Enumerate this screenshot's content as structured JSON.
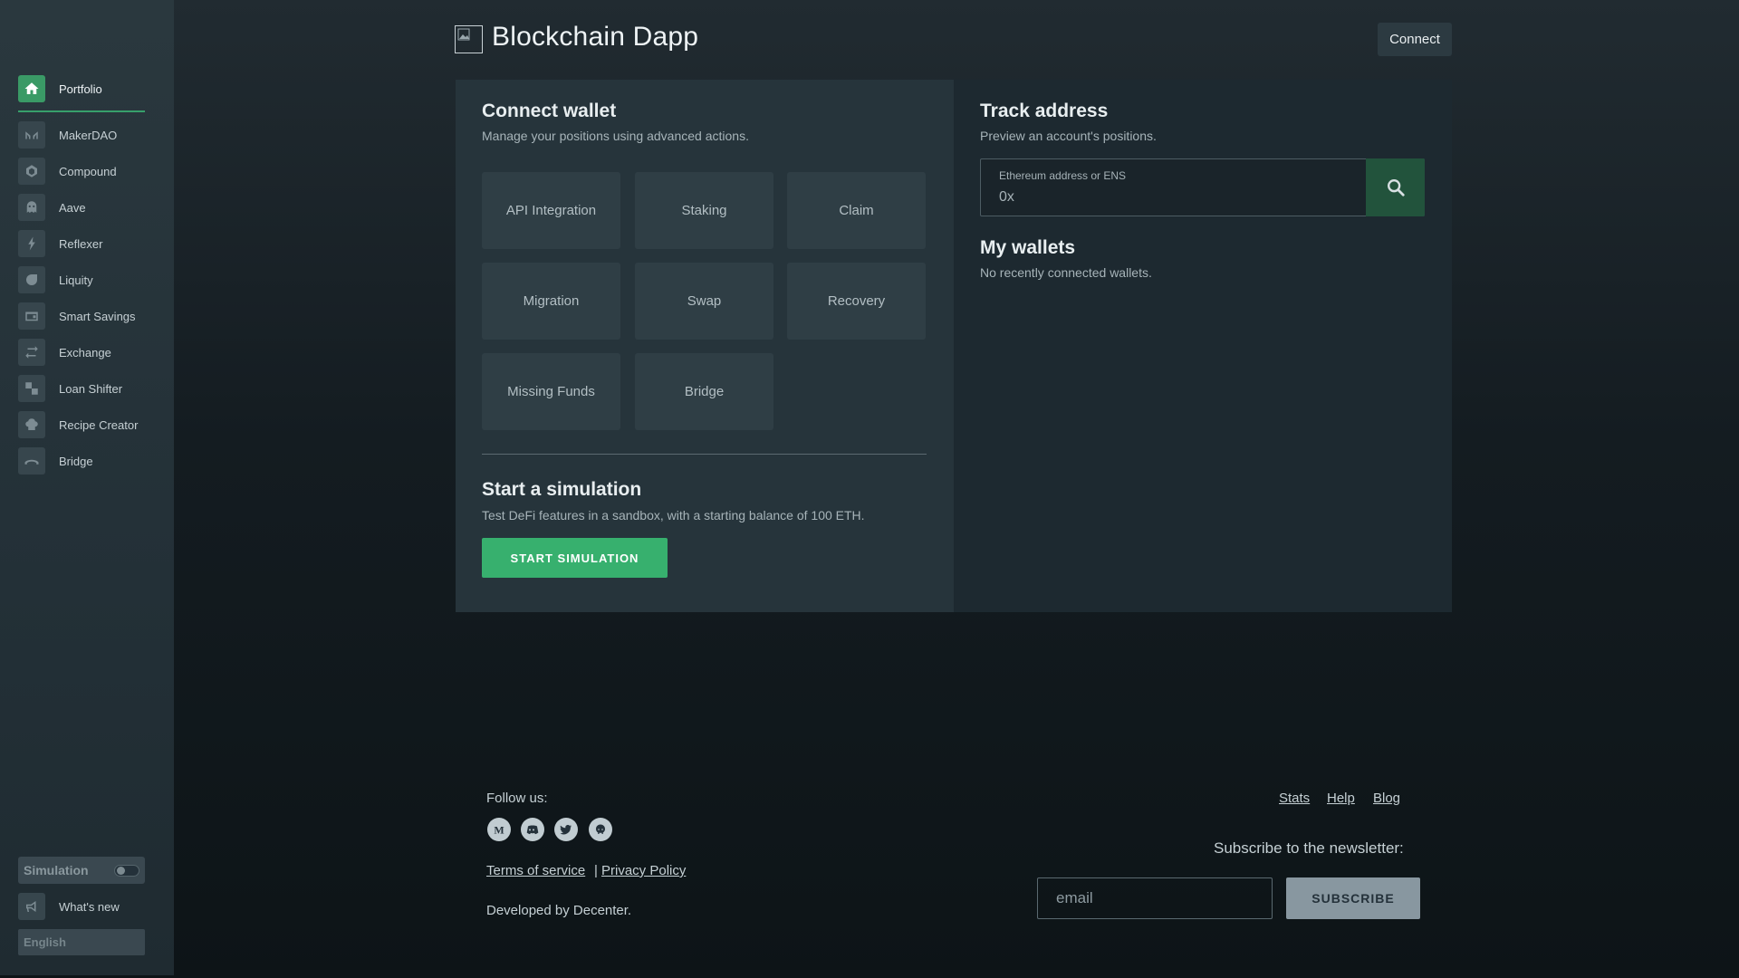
{
  "app": {
    "title": "Blockchain Dapp",
    "connect_label": "Connect"
  },
  "sidebar": {
    "items": [
      {
        "label": "Portfolio",
        "icon": "home-icon",
        "active": true
      },
      {
        "label": "MakerDAO",
        "icon": "makerdao-icon"
      },
      {
        "label": "Compound",
        "icon": "compound-icon"
      },
      {
        "label": "Aave",
        "icon": "aave-icon"
      },
      {
        "label": "Reflexer",
        "icon": "reflexer-icon"
      },
      {
        "label": "Liquity",
        "icon": "liquity-icon"
      },
      {
        "label": "Smart Savings",
        "icon": "smart-savings-icon"
      },
      {
        "label": "Exchange",
        "icon": "exchange-icon"
      },
      {
        "label": "Loan Shifter",
        "icon": "loan-shifter-icon"
      },
      {
        "label": "Recipe Creator",
        "icon": "recipe-creator-icon"
      },
      {
        "label": "Bridge",
        "icon": "bridge-icon"
      }
    ],
    "simulation_label": "Simulation",
    "whats_new_label": "What's new",
    "language": "English"
  },
  "connect_wallet": {
    "title": "Connect wallet",
    "subtitle": "Manage your positions using advanced actions.",
    "options": [
      "API Integration",
      "Staking",
      "Claim",
      "Migration",
      "Swap",
      "Recovery",
      "Missing Funds",
      "Bridge"
    ]
  },
  "simulation": {
    "title": "Start a simulation",
    "subtitle": "Test DeFi features in a sandbox, with a starting balance of 100 ETH.",
    "button_label": "START SIMULATION"
  },
  "track_address": {
    "title": "Track address",
    "subtitle": "Preview an account's positions.",
    "field_label": "Ethereum address or ENS",
    "placeholder": "0x"
  },
  "my_wallets": {
    "title": "My wallets",
    "empty_text": "No recently connected wallets."
  },
  "footer": {
    "follow_label": "Follow us:",
    "socials": [
      "medium-icon",
      "discord-icon",
      "twitter-icon",
      "github-icon"
    ],
    "terms_label": "Terms of service",
    "separator": "|",
    "privacy_label": "Privacy Policy",
    "developed_by": "Developed by Decenter.",
    "links": [
      "Stats",
      "Help",
      "Blog"
    ],
    "newsletter_label": "Subscribe to the newsletter:",
    "email_placeholder": "email",
    "subscribe_label": "SUBSCRIBE"
  },
  "colors": {
    "accent": "#37b06e",
    "sidebar_bg": "#26343b",
    "card_bg": "#26343b",
    "tile_bg": "#2f3e45",
    "search_button": "#22533c"
  }
}
